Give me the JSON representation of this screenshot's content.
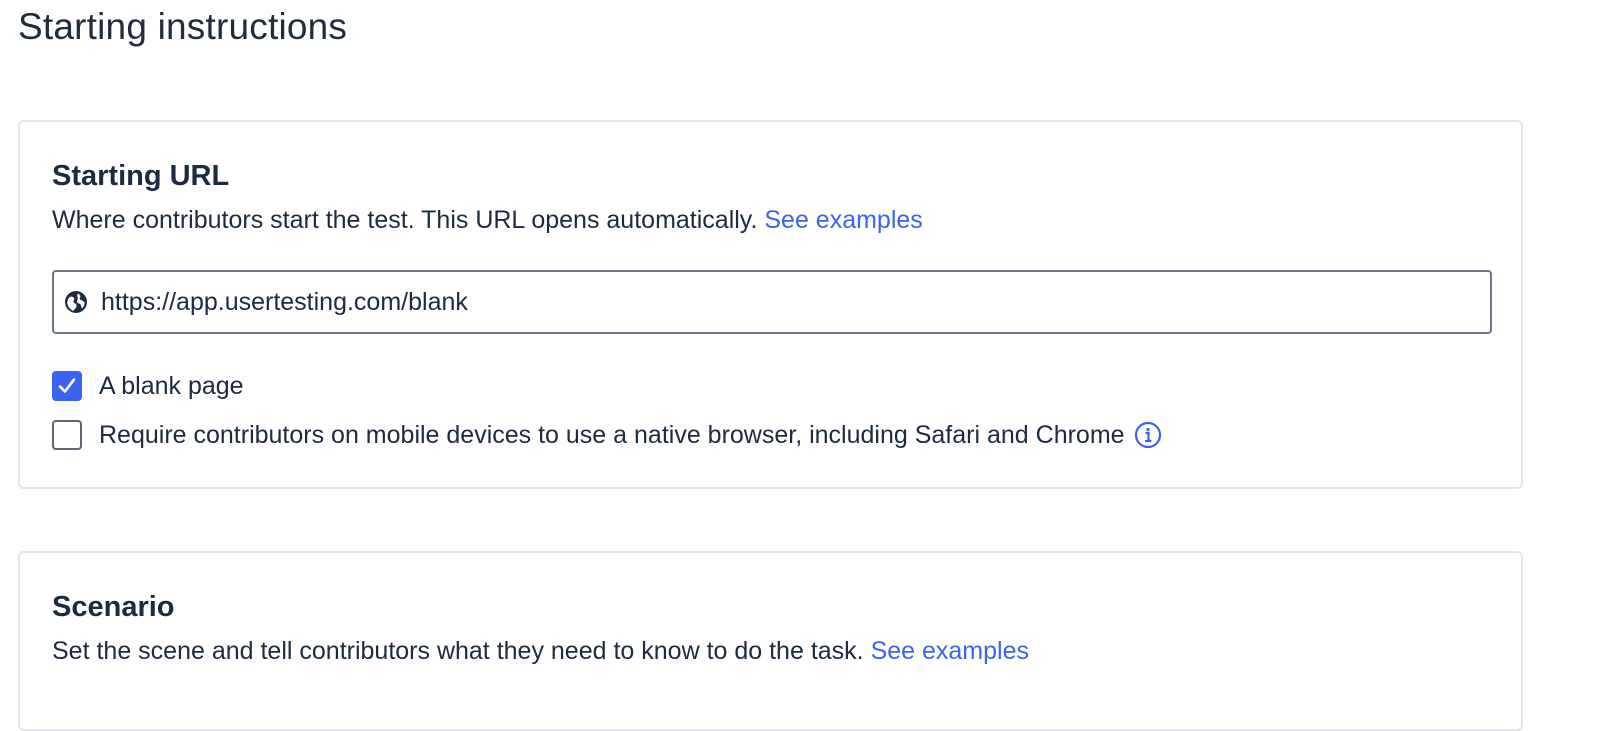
{
  "page": {
    "title": "Starting instructions"
  },
  "starting_url": {
    "heading": "Starting URL",
    "description": "Where contributors start the test. This URL opens automatically.",
    "examples_link": "See examples",
    "url_value": "https://app.usertesting.com/blank",
    "globe_icon": "globe-icon",
    "options": [
      {
        "label": "A blank page",
        "checked": true
      },
      {
        "label": "Require contributors on mobile devices to use a native browser, including Safari and Chrome",
        "checked": false
      }
    ],
    "info_icon": "info-icon"
  },
  "scenario": {
    "heading": "Scenario",
    "description": "Set the scene and tell contributors what they need to know to do the task.",
    "examples_link": "See examples"
  },
  "colors": {
    "accent": "#3b63f0",
    "text": "#1c2b40",
    "border": "#e2e5e9"
  }
}
